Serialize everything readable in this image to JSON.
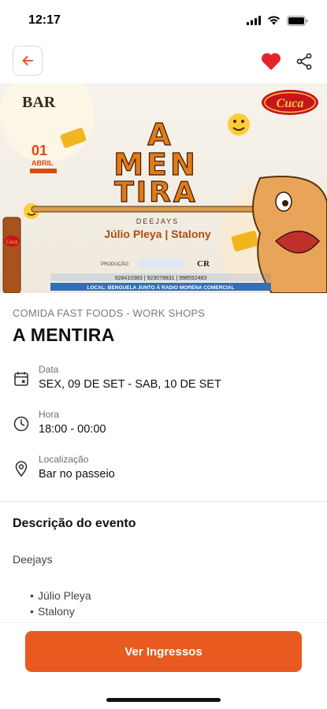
{
  "status": {
    "time": "12:17"
  },
  "banner": {
    "brand": "BAR",
    "sponsor": "Cuca",
    "date_day": "01",
    "date_month": "ABRIL",
    "title_line1": "A",
    "title_line2": "MEN",
    "title_line3": "TIRA",
    "deejays_label": "DEEJAYS",
    "performers": "Júlio Pleya | Stalony",
    "production_label": "PRODUÇÃO:",
    "producer_logo": "CR",
    "phones": "928410383 | 923078831 | 998592483",
    "location": "LOCAL: BENGUELA JUNTO À RADIO MORENA COMERCIAL",
    "bottle_label": "Cuca"
  },
  "event": {
    "category": "COMIDA FAST FOODS - WORK SHOPS",
    "title": "A MENTIRA"
  },
  "info": {
    "date_label": "Data",
    "date_value": "SEX, 09 DE SET - SAB, 10 DE SET",
    "time_label": "Hora",
    "time_value": "18:00 - 00:00",
    "location_label": "Localização",
    "location_value": "Bar no passeio"
  },
  "description": {
    "title": "Descrição do evento",
    "intro": "Deejays",
    "items": [
      "Júlio Pleya",
      "Stalony"
    ]
  },
  "cta": {
    "label": "Ver Ingressos"
  },
  "colors": {
    "accent": "#e85a1f",
    "heart": "#e3242b"
  },
  "icons": [
    "back-arrow-icon",
    "heart-icon",
    "share-icon",
    "calendar-icon",
    "clock-icon",
    "location-pin-icon",
    "signal-icon",
    "wifi-icon",
    "battery-icon"
  ]
}
